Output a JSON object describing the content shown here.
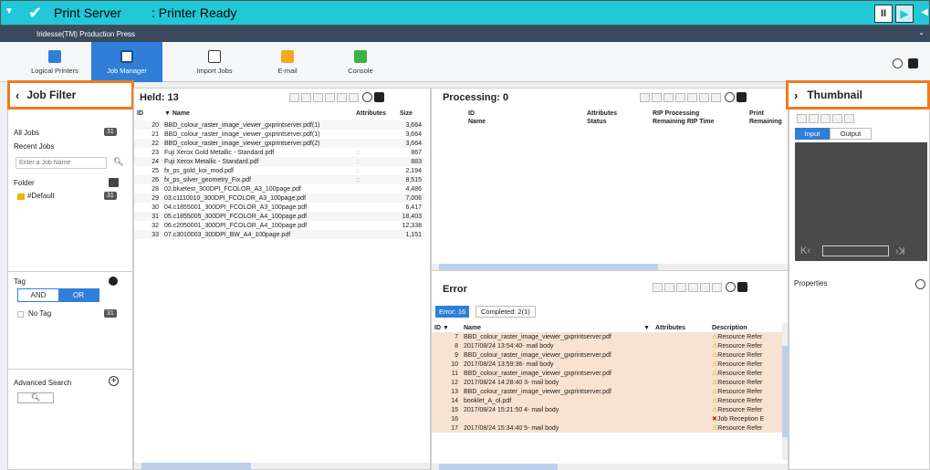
{
  "header": {
    "app_name": "Print Server",
    "status": ": Printer Ready",
    "product": "Iridesse(TM) Production Press"
  },
  "toolbar": {
    "items": [
      {
        "label": "Logical Printers"
      },
      {
        "label": "Job Manager"
      },
      {
        "label": "Import Jobs"
      },
      {
        "label": "E-mail"
      },
      {
        "label": "Console"
      }
    ]
  },
  "job_filter": {
    "title": "Job Filter",
    "all_jobs": "All Jobs",
    "all_jobs_count": "31",
    "recent_jobs": "Recent Jobs",
    "search_placeholder": "Enter a Job Name",
    "folder": "Folder",
    "folder_item": "#Default",
    "folder_count": "31",
    "tag": "Tag",
    "and": "AND",
    "or": "OR",
    "no_tag": "No Tag",
    "no_tag_count": "31",
    "advanced_search": "Advanced Search"
  },
  "held": {
    "title": "Held: 13",
    "columns": [
      "ID",
      "Name",
      "Attributes",
      "Size"
    ],
    "rows": [
      {
        "id": "20",
        "name": "BBD_colour_raster_image_viewer_gxprintserver.pdf(1)",
        "attr": "",
        "size": "3,664"
      },
      {
        "id": "21",
        "name": "BBD_colour_raster_image_viewer_gxprintserver.pdf(1)",
        "attr": "",
        "size": "3,664"
      },
      {
        "id": "22",
        "name": "BBD_colour_raster_image_viewer_gxprintserver.pdf(2)",
        "attr": "",
        "size": "3,664"
      },
      {
        "id": "23",
        "name": "Fuji Xerox Gold Metallic - Standard.pdf",
        "attr": "::",
        "size": "867"
      },
      {
        "id": "24",
        "name": "Fuji Xerox Metallic - Standard.pdf",
        "attr": "::",
        "size": "883"
      },
      {
        "id": "25",
        "name": "fx_ps_gold_koi_mod.pdf",
        "attr": "::",
        "size": "2,194"
      },
      {
        "id": "26",
        "name": "fx_ps_silver_geometry_Fix.pdf",
        "attr": "::",
        "size": "8,515"
      },
      {
        "id": "28",
        "name": "02.bluetest_300DPI_FCOLOR_A3_100page.pdf",
        "attr": "",
        "size": "4,486"
      },
      {
        "id": "29",
        "name": "03.c1110010_300DPI_FCOLOR_A3_100page.pdf",
        "attr": "",
        "size": "7,006"
      },
      {
        "id": "30",
        "name": "04.c1855001_300DPI_FCOLOR_A3_100page.pdf",
        "attr": "",
        "size": "6,417"
      },
      {
        "id": "31",
        "name": "05.c1855005_300DPI_FCOLOR_A4_100page.pdf",
        "attr": "",
        "size": "18,403"
      },
      {
        "id": "32",
        "name": "06.c2050001_300DPI_FCOLOR_A4_100page.pdf",
        "attr": "",
        "size": "12,338"
      },
      {
        "id": "33",
        "name": "07.c3010003_300DPI_BW_A4_100page.pdf",
        "attr": "",
        "size": "1,151"
      }
    ]
  },
  "processing": {
    "title": "Processing: 0",
    "col_id": "ID",
    "col_name": "Name",
    "col_attr": "Attributes",
    "col_status": "Status",
    "col_rip": "RIP Processing",
    "col_rip_time": "Remaining RIP Time",
    "col_print": "Print",
    "col_remaining": "Remaining"
  },
  "error": {
    "title": "Error",
    "tab_error": "Error: 16",
    "tab_completed": "Completed: 2(1)",
    "columns": [
      "ID",
      "Name",
      "Attributes",
      "Description"
    ],
    "rows": [
      {
        "id": "7",
        "name": "BBD_colour_raster_image_viewer_gxprintserver.pdf",
        "desc": "Resource Refer",
        "kind": "warn"
      },
      {
        "id": "8",
        "name": "2017/08/24 13:54:40- mail body",
        "desc": "Resource Refer",
        "kind": "warn"
      },
      {
        "id": "9",
        "name": "BBD_colour_raster_image_viewer_gxprintserver.pdf",
        "desc": "Resource Refer",
        "kind": "warn"
      },
      {
        "id": "10",
        "name": "2017/08/24 13:59:36- mail body",
        "desc": "Resource Refer",
        "kind": "warn"
      },
      {
        "id": "11",
        "name": "BBD_colour_raster_image_viewer_gxprintserver.pdf",
        "desc": "Resource Refer",
        "kind": "warn"
      },
      {
        "id": "12",
        "name": "2017/08/24 14:28:40 3- mail body",
        "desc": "Resource Refer",
        "kind": "warn"
      },
      {
        "id": "13",
        "name": "BBD_colour_raster_image_viewer_gxprintserver.pdf",
        "desc": "Resource Refer",
        "kind": "warn"
      },
      {
        "id": "14",
        "name": "booklet_A_ol.pdf",
        "desc": "Resource Refer",
        "kind": "warn"
      },
      {
        "id": "15",
        "name": "2017/08/24 15:21:50 4- mail body",
        "desc": "Resource Refer",
        "kind": "warn"
      },
      {
        "id": "16",
        "name": "",
        "desc": "Job Reception E",
        "kind": "err"
      },
      {
        "id": "17",
        "name": "2017/08/24 15:34:40 5- mail body",
        "desc": "Resource Refer",
        "kind": "warn"
      }
    ]
  },
  "thumbnail": {
    "title": "Thumbnail",
    "tab_input": "Input",
    "tab_output": "Output",
    "properties": "Properties"
  },
  "colors": {
    "header": "#20c8d8",
    "accent": "#2f7fd8",
    "highlight": "#f07a1e",
    "error_row": "#f8e3d2"
  }
}
